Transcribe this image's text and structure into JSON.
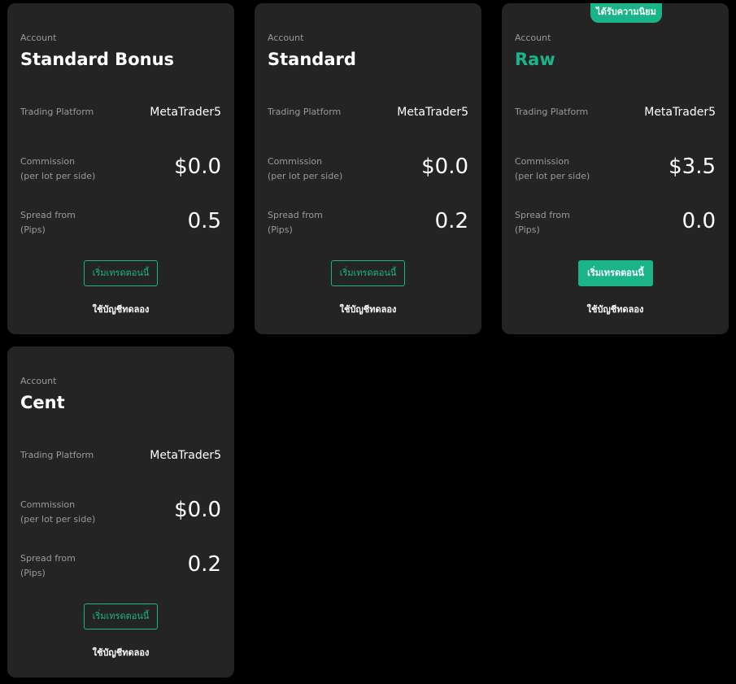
{
  "cards": [
    {
      "account_label": "Account",
      "name": "Standard Bonus",
      "platform_label": "Trading Platform",
      "platform_value": "MetaTrader5",
      "commission_label_1": "Commission",
      "commission_label_2": "(per lot per side)",
      "commission_value": "$0.0",
      "spread_label_1": "Spread from",
      "spread_label_2": "(Pips)",
      "spread_value": "0.5",
      "cta_label": "เริ่มเทรดตอนนี้",
      "demo_label": "ใช้บัญชีทดลอง"
    },
    {
      "account_label": "Account",
      "name": "Standard",
      "platform_label": "Trading Platform",
      "platform_value": "MetaTrader5",
      "commission_label_1": "Commission",
      "commission_label_2": "(per lot per side)",
      "commission_value": "$0.0",
      "spread_label_1": "Spread from",
      "spread_label_2": "(Pips)",
      "spread_value": "0.2",
      "cta_label": "เริ่มเทรดตอนนี้",
      "demo_label": "ใช้บัญชีทดลอง"
    },
    {
      "badge": "ได้รับความนิยม",
      "account_label": "Account",
      "name": "Raw",
      "platform_label": "Trading Platform",
      "platform_value": "MetaTrader5",
      "commission_label_1": "Commission",
      "commission_label_2": "(per lot per side)",
      "commission_value": "$3.5",
      "spread_label_1": "Spread from",
      "spread_label_2": "(Pips)",
      "spread_value": "0.0",
      "cta_label": "เริ่มเทรดตอนนี้",
      "demo_label": "ใช้บัญชีทดลอง"
    },
    {
      "account_label": "Account",
      "name": "Cent",
      "platform_label": "Trading Platform",
      "platform_value": "MetaTrader5",
      "commission_label_1": "Commission",
      "commission_label_2": "(per lot per side)",
      "commission_value": "$0.0",
      "spread_label_1": "Spread from",
      "spread_label_2": "(Pips)",
      "spread_value": "0.2",
      "cta_label": "เริ่มเทรดตอนนี้",
      "demo_label": "ใช้บัญชีทดลอง"
    }
  ],
  "colors": {
    "accent": "#1bb488",
    "card_bg": "#242424",
    "page_bg": "#000000",
    "muted_text": "#9a9a9a"
  }
}
